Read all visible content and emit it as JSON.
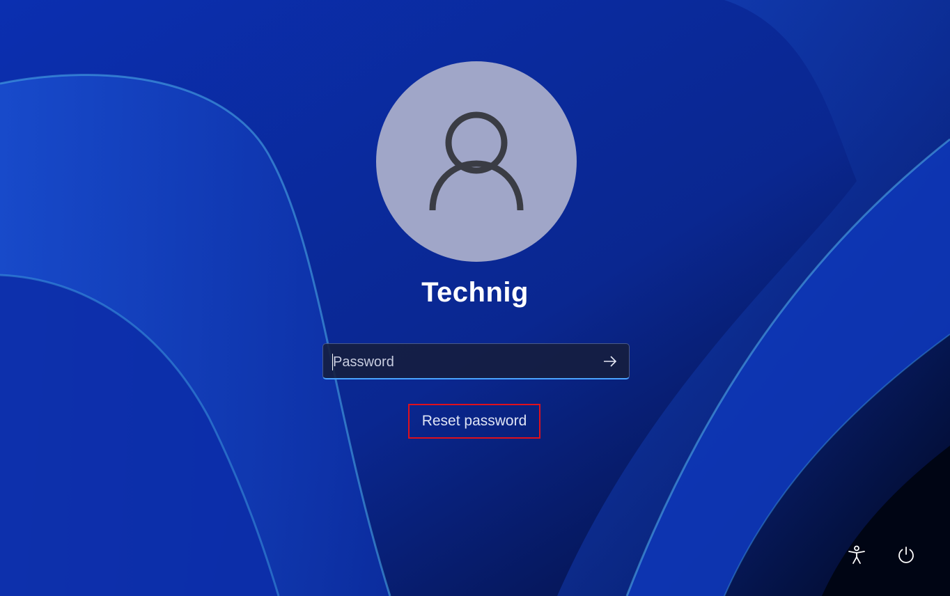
{
  "account": {
    "username": "Technig"
  },
  "password_field": {
    "placeholder": "Password",
    "value": ""
  },
  "submit": {
    "icon": "arrow-right-icon"
  },
  "reset_link": {
    "label": "Reset password"
  },
  "corner_controls": {
    "accessibility_icon": "accessibility-icon",
    "power_icon": "power-icon"
  },
  "colors": {
    "background": "#0a2a9e",
    "avatar": "#a0a6c8",
    "focus_underline": "#4aa3ff",
    "highlight_box": "#e0101c"
  }
}
